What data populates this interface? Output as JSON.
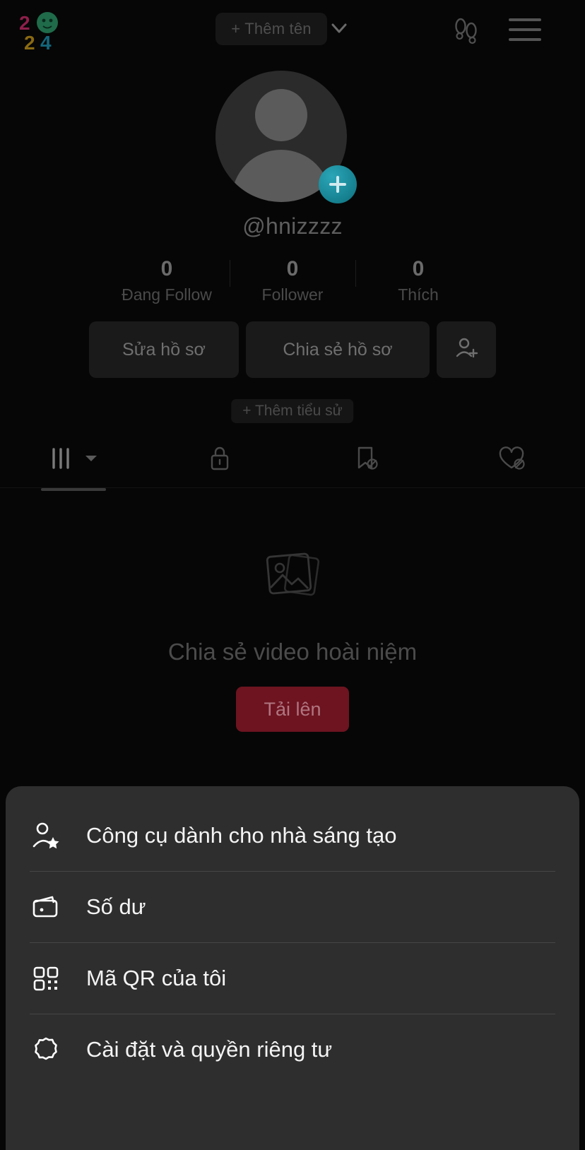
{
  "app": {
    "platform": "tiktok-profile",
    "colors": {
      "background": "#060606",
      "sheet_background": "#2e2e2e",
      "accent_upload": "#6d1420",
      "accent_badge": "#16808f"
    }
  },
  "topbar": {
    "logo_label": "2024",
    "add_name_chip": "+ Thêm tên",
    "chevron_icon": "chevron-down-icon",
    "footprints_icon": "footprints-icon",
    "menu_icon": "hamburger-menu-icon"
  },
  "profile": {
    "avatar_icon": "default-avatar-icon",
    "add_story_badge": "plus-icon",
    "username": "@hnizzzz",
    "stats": [
      {
        "value": "0",
        "label": "Đang Follow"
      },
      {
        "value": "0",
        "label": "Follower"
      },
      {
        "value": "0",
        "label": "Thích"
      }
    ],
    "buttons": {
      "edit_profile": "Sửa hồ sơ",
      "share_profile": "Chia sẻ hồ sơ",
      "add_friend_icon": "add-person-icon"
    },
    "add_bio": "+ Thêm tiểu sử"
  },
  "tabs": [
    {
      "name": "tab-posts",
      "icon": "grid-icon",
      "active": true,
      "has_dropdown": true
    },
    {
      "name": "tab-private",
      "icon": "lock-icon",
      "active": false,
      "has_dropdown": false
    },
    {
      "name": "tab-saved",
      "icon": "bookmark-hidden-icon",
      "active": false,
      "has_dropdown": false
    },
    {
      "name": "tab-liked",
      "icon": "heart-hidden-icon",
      "active": false,
      "has_dropdown": false
    }
  ],
  "empty_state": {
    "icon": "photo-stack-icon",
    "text": "Chia sẻ video hoài niệm",
    "upload_button": "Tải lên"
  },
  "sheet": {
    "items": [
      {
        "label": "Công cụ dành cho nhà sáng tạo",
        "icon": "person-star-icon",
        "name": "creator-tools"
      },
      {
        "label": "Số dư",
        "icon": "wallet-icon",
        "name": "balance"
      },
      {
        "label": "Mã QR của tôi",
        "icon": "qr-code-icon",
        "name": "my-qr-code"
      },
      {
        "label": "Cài đặt và quyền riêng tư",
        "icon": "gear-icon",
        "name": "settings-and-privacy"
      }
    ]
  }
}
